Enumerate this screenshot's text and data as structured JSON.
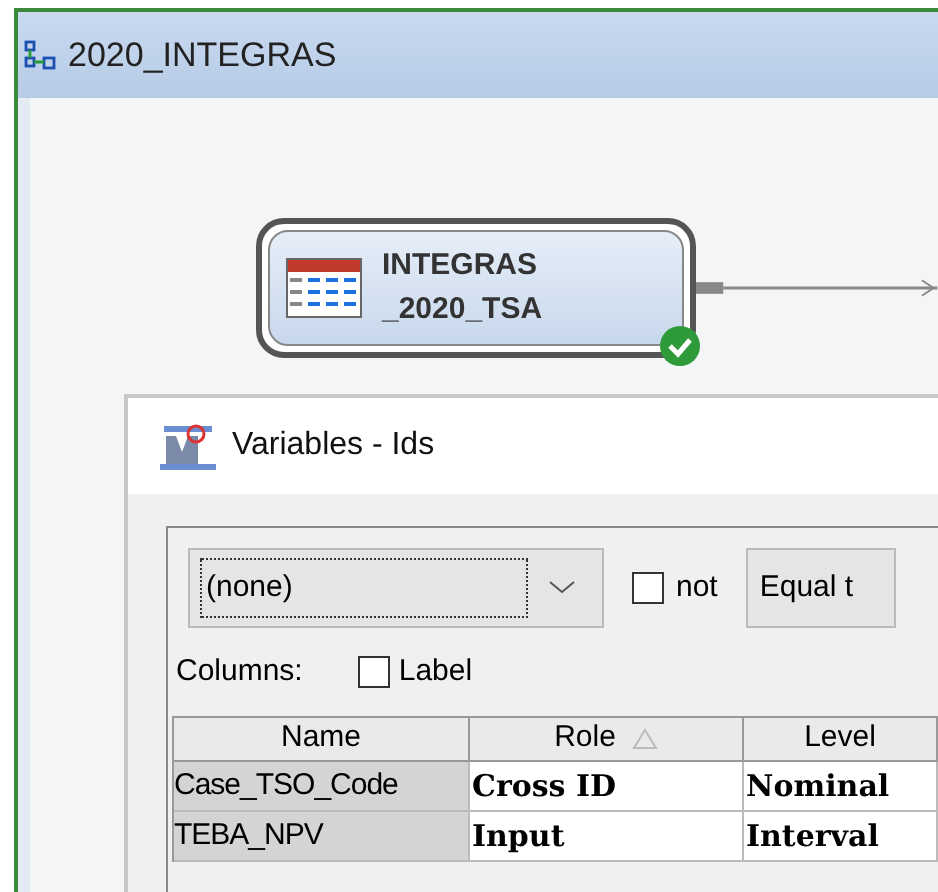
{
  "window": {
    "title": "2020_INTEGRAS"
  },
  "diagram": {
    "node": {
      "label_lines": [
        "INTEGRAS",
        "_2020_TSA"
      ],
      "completed": true
    }
  },
  "dialog": {
    "title": "Variables - Ids",
    "filter": {
      "value": "(none)",
      "not_label": "not",
      "not_checked": false,
      "operator": "Equal t"
    },
    "columns_label": "Columns:",
    "label_option": {
      "text": "Label",
      "checked": false
    },
    "table": {
      "columns": [
        {
          "label": "Name",
          "sorted": false
        },
        {
          "label": "Role",
          "sorted": true
        },
        {
          "label": "Level",
          "sorted": false
        }
      ],
      "rows": [
        {
          "cells": [
            "Case_TSO_Code",
            "Cross ID",
            "Nominal"
          ]
        },
        {
          "cells": [
            "TEBA_NPV",
            "Input",
            "Interval"
          ]
        }
      ]
    }
  }
}
